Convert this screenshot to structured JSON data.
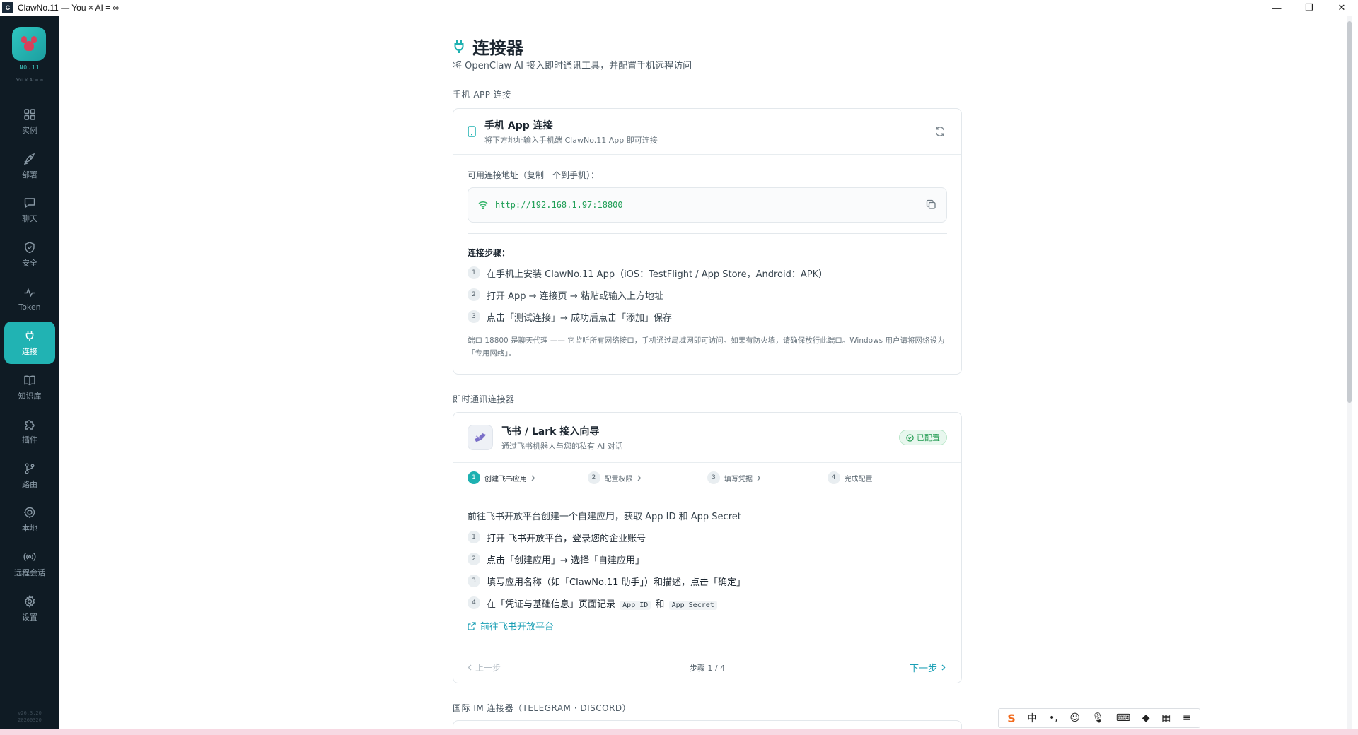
{
  "window": {
    "title": "ClawNo.11 — You × AI = ∞",
    "minimize": "—",
    "restore": "❐",
    "close": "✕"
  },
  "sidebar": {
    "logo_num": "NO.11",
    "logo_sub": "You × AI = ∞",
    "items": [
      {
        "label": "实例",
        "icon": "grid-icon"
      },
      {
        "label": "部署",
        "icon": "rocket-icon"
      },
      {
        "label": "聊天",
        "icon": "chat-icon"
      },
      {
        "label": "安全",
        "icon": "shield-icon"
      },
      {
        "label": "Token",
        "icon": "pulse-icon"
      },
      {
        "label": "连接",
        "icon": "plug-icon",
        "active": true
      },
      {
        "label": "知识库",
        "icon": "book-icon"
      },
      {
        "label": "插件",
        "icon": "puzzle-icon"
      },
      {
        "label": "路由",
        "icon": "branch-icon"
      },
      {
        "label": "本地",
        "icon": "cpu-icon"
      },
      {
        "label": "远程会话",
        "icon": "broadcast-icon"
      },
      {
        "label": "设置",
        "icon": "gear-icon"
      }
    ],
    "version_line1": "v26.3.20",
    "version_line2": "20260320"
  },
  "page": {
    "title": "连接器",
    "subtitle": "将 OpenClaw AI 接入即时通讯工具，并配置手机远程访问"
  },
  "mobile_section": {
    "label": "手机 APP 连接",
    "card_title": "手机 App 连接",
    "card_subtitle": "将下方地址输入手机端 ClawNo.11 App 即可连接",
    "address_label": "可用连接地址（复制一个到手机）：",
    "address": "http://192.168.1.97:18800",
    "steps_title": "连接步骤：",
    "steps": [
      {
        "num": "1",
        "text": "在手机上安装 ClawNo.11 App（iOS：TestFlight / App Store，Android：APK）"
      },
      {
        "num": "2",
        "text": "打开 App → 连接页 → 粘贴或输入上方地址"
      },
      {
        "num": "3",
        "text": "点击「测试连接」→ 成功后点击「添加」保存"
      }
    ],
    "note": "端口 18800 是聊天代理 —— 它监听所有网络接口，手机通过局域网即可访问。如果有防火墙，请确保放行此端口。Windows 用户请将网络设为「专用网络」。"
  },
  "im_section": {
    "label": "即时通讯连接器",
    "card_title": "飞书 / Lark 接入向导",
    "card_subtitle": "通过飞书机器人与您的私有 AI 对话",
    "badge": "已配置",
    "wizard_steps": [
      {
        "num": "1",
        "label": "创建飞书应用",
        "active": true
      },
      {
        "num": "2",
        "label": "配置权限"
      },
      {
        "num": "3",
        "label": "填写凭据"
      },
      {
        "num": "4",
        "label": "完成配置"
      }
    ],
    "intro": "前往飞书开放平台创建一个自建应用，获取 App ID 和 App Secret",
    "steps": [
      {
        "num": "1",
        "text": "打开 飞书开放平台，登录您的企业账号"
      },
      {
        "num": "2",
        "text": "点击「创建应用」→ 选择「自建应用」"
      },
      {
        "num": "3",
        "text": "填写应用名称（如「ClawNo.11 助手」）和描述，点击「确定」"
      }
    ],
    "step4_num": "4",
    "step4_prefix": "在「凭证与基础信息」页面记录",
    "step4_code1": "App ID",
    "step4_and": "和",
    "step4_code2": "App Secret",
    "link": "前往飞书开放平台",
    "prev": "上一步",
    "page_indicator": "步骤 1 / 4",
    "next": "下一步"
  },
  "intl_section": {
    "label": "国际 IM 连接器（TELEGRAM · DISCORD）"
  },
  "ime": {
    "lang": "中",
    "punct": "•,"
  },
  "colors": {
    "accent": "#1eb1b1",
    "sidebar_bg": "#0f1b24",
    "success": "#1f9a4f",
    "link": "#1a9fb5"
  }
}
